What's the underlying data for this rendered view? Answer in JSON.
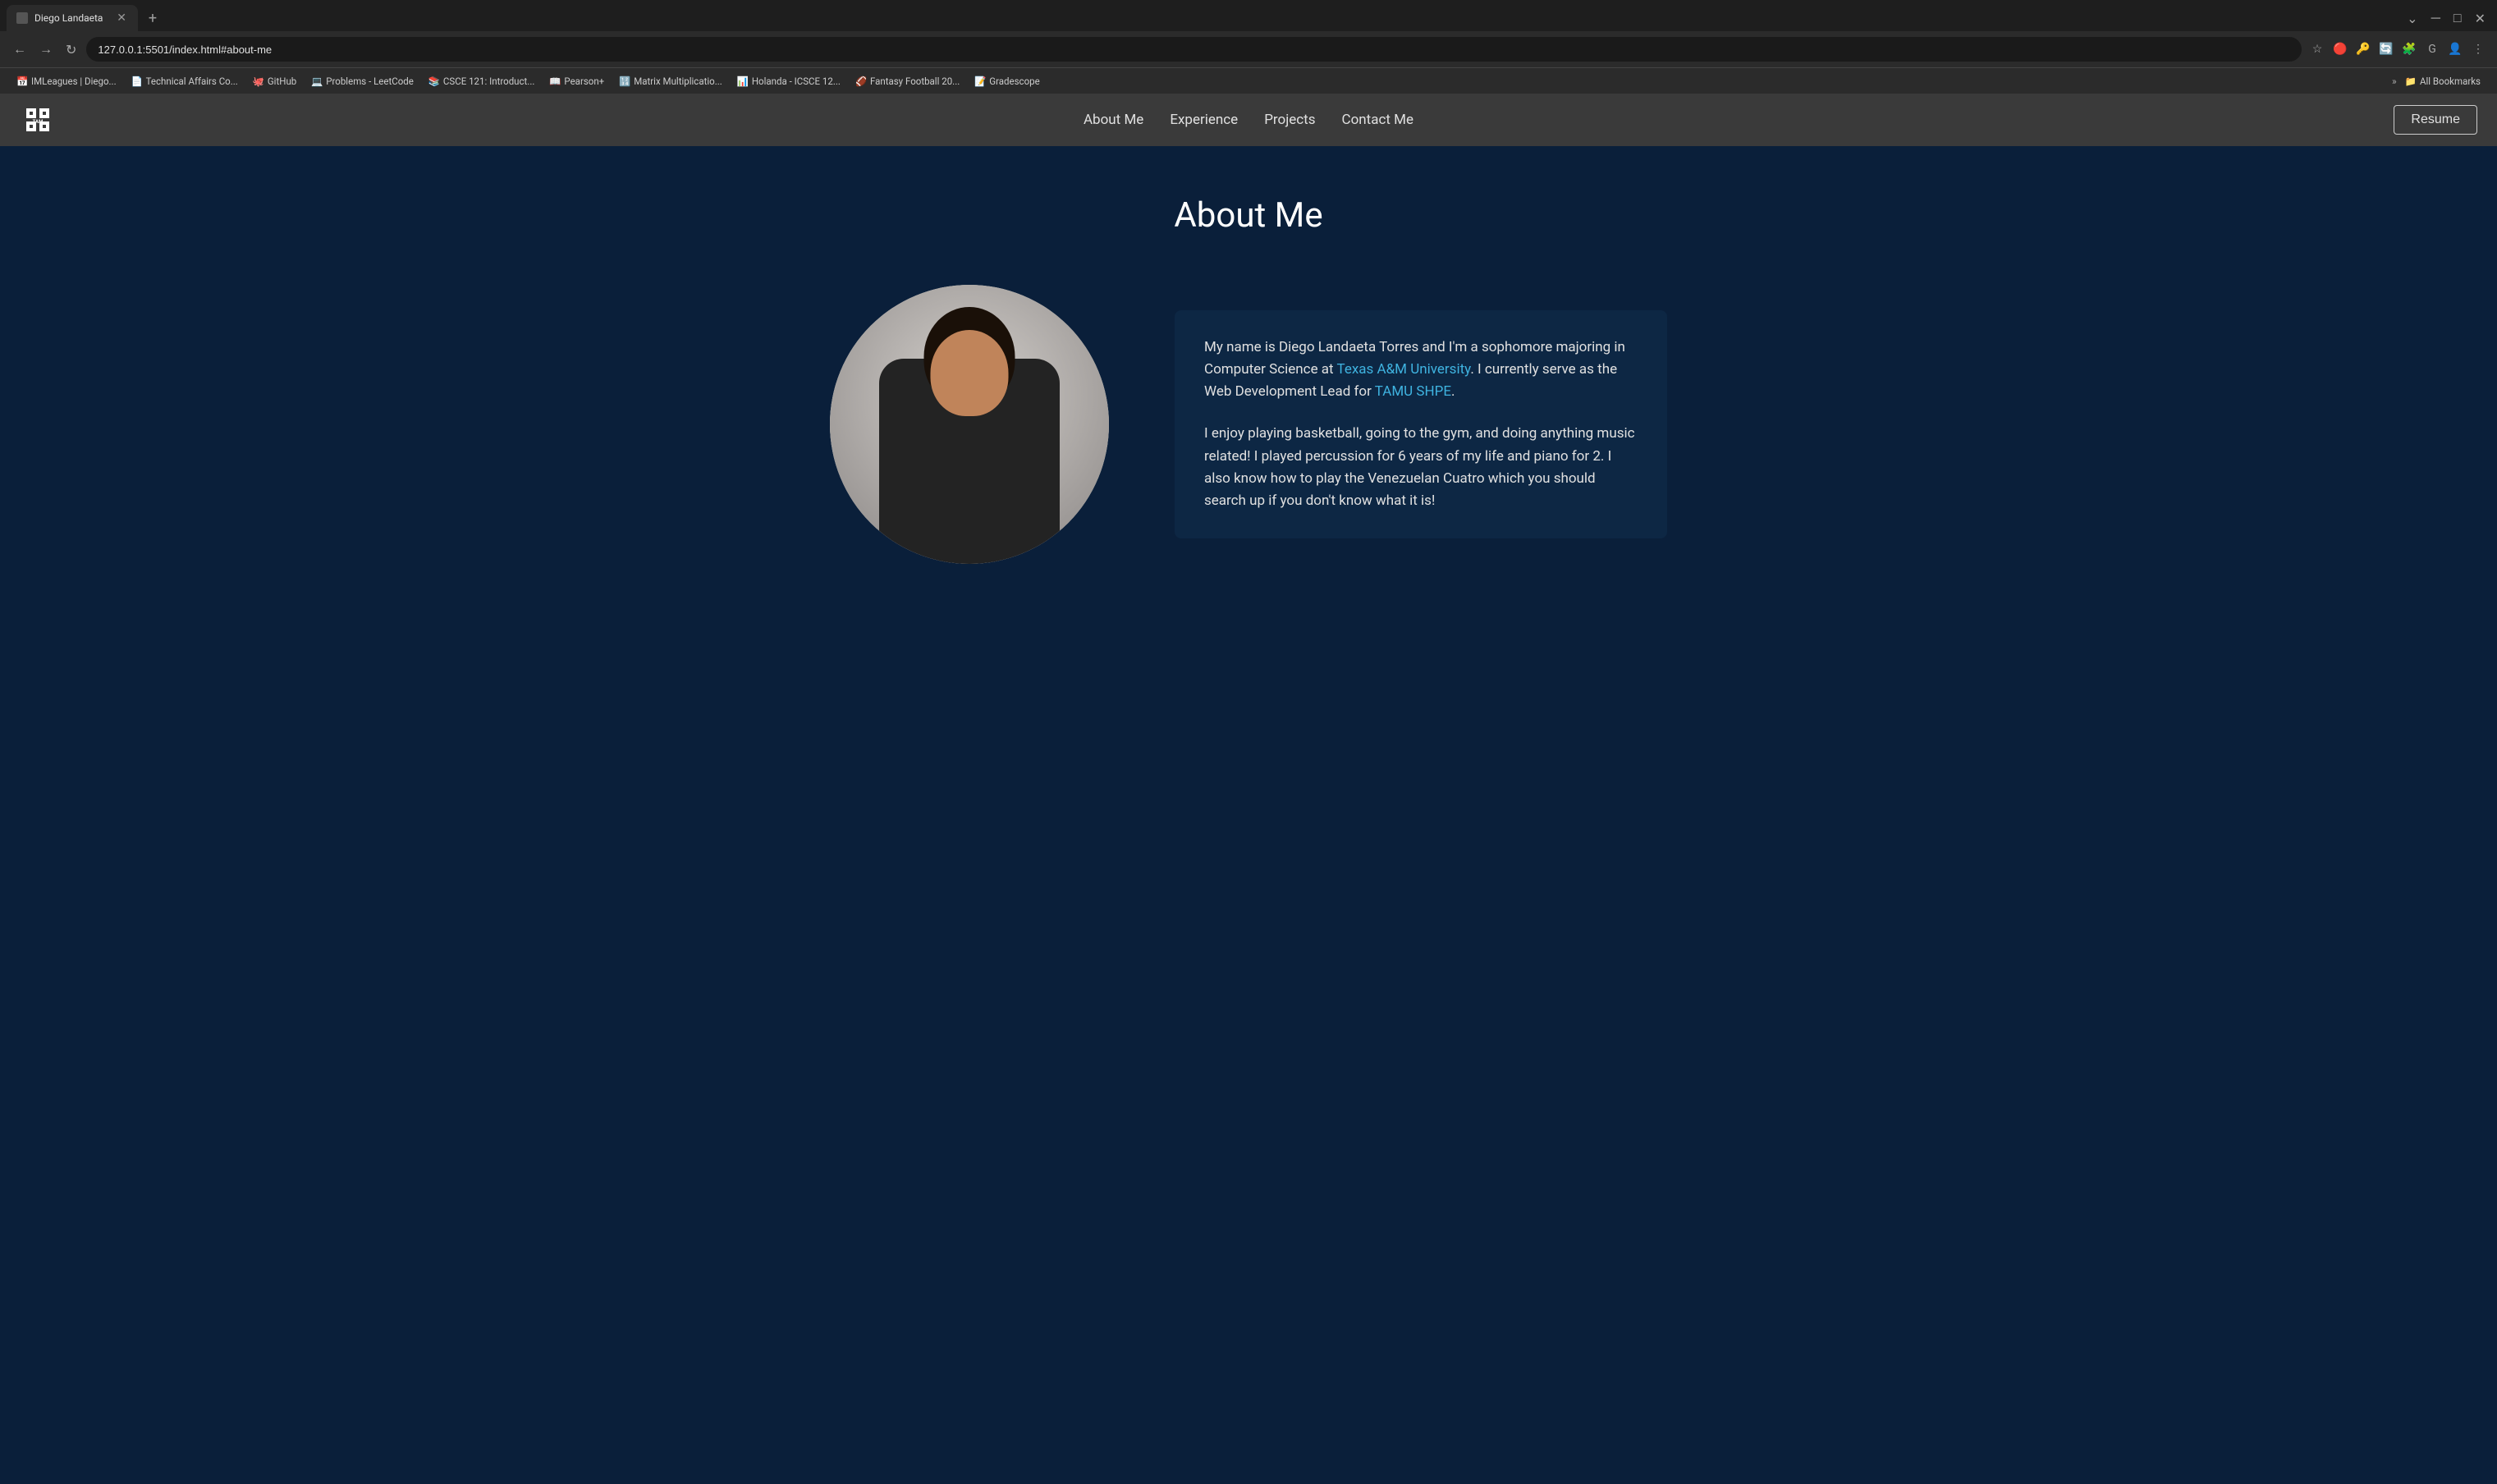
{
  "browser": {
    "tab": {
      "title": "Diego Landaeta",
      "url": "127.0.0.1:5501/index.html#about-me",
      "url_full": "127.0.0.1:5501/index.html#about-me"
    },
    "bookmarks": [
      {
        "label": "IMLeagues | Diego...",
        "icon": "📅"
      },
      {
        "label": "Technical Affairs Co...",
        "icon": "📄"
      },
      {
        "label": "GitHub",
        "icon": "🐙"
      },
      {
        "label": "Problems - LeetCode",
        "icon": "💻"
      },
      {
        "label": "CSCE 121: Introduct...",
        "icon": "📚"
      },
      {
        "label": "Pearson+",
        "icon": "📖"
      },
      {
        "label": "Matrix Multiplicatio...",
        "icon": "🔢"
      },
      {
        "label": "Holanda - ICSCE 12...",
        "icon": "📊"
      },
      {
        "label": "Fantasy Football 20...",
        "icon": "🏈"
      },
      {
        "label": "Gradescope",
        "icon": "📝"
      }
    ],
    "all_bookmarks_label": "All Bookmarks"
  },
  "nav": {
    "logo_alt": "Texas A&M Logo",
    "links": [
      {
        "label": "About Me",
        "href": "#about-me"
      },
      {
        "label": "Experience",
        "href": "#experience"
      },
      {
        "label": "Projects",
        "href": "#projects"
      },
      {
        "label": "Contact Me",
        "href": "#contact"
      }
    ],
    "resume_btn": "Resume"
  },
  "page": {
    "title": "About Me",
    "bio_paragraph1_plain": "My name is Diego Landaeta Torres and I'm a sophomore majoring in Computer Science at ",
    "bio_paragraph1_link1": "Texas A&M University",
    "bio_paragraph1_mid": ". I currently serve as the Web Development Lead for ",
    "bio_paragraph1_link2": "TAMU SHPE",
    "bio_paragraph1_end": ".",
    "bio_paragraph2": "I enjoy playing basketball, going to the gym, and doing anything music related! I played percussion for 6 years of my life and piano for 2. I also know how to play the Venezuelan Cuatro which you should search up if you don't know what it is!",
    "tamu_link": "https://www.tamu.edu",
    "shpe_link": "https://tamushpe.org"
  },
  "colors": {
    "bg_main": "#0a1f3a",
    "bg_nav": "#3a3a3a",
    "bg_card": "#0d2744",
    "accent": "#3fb3e0",
    "text_primary": "#ffffff",
    "text_secondary": "#e0e0e0"
  }
}
